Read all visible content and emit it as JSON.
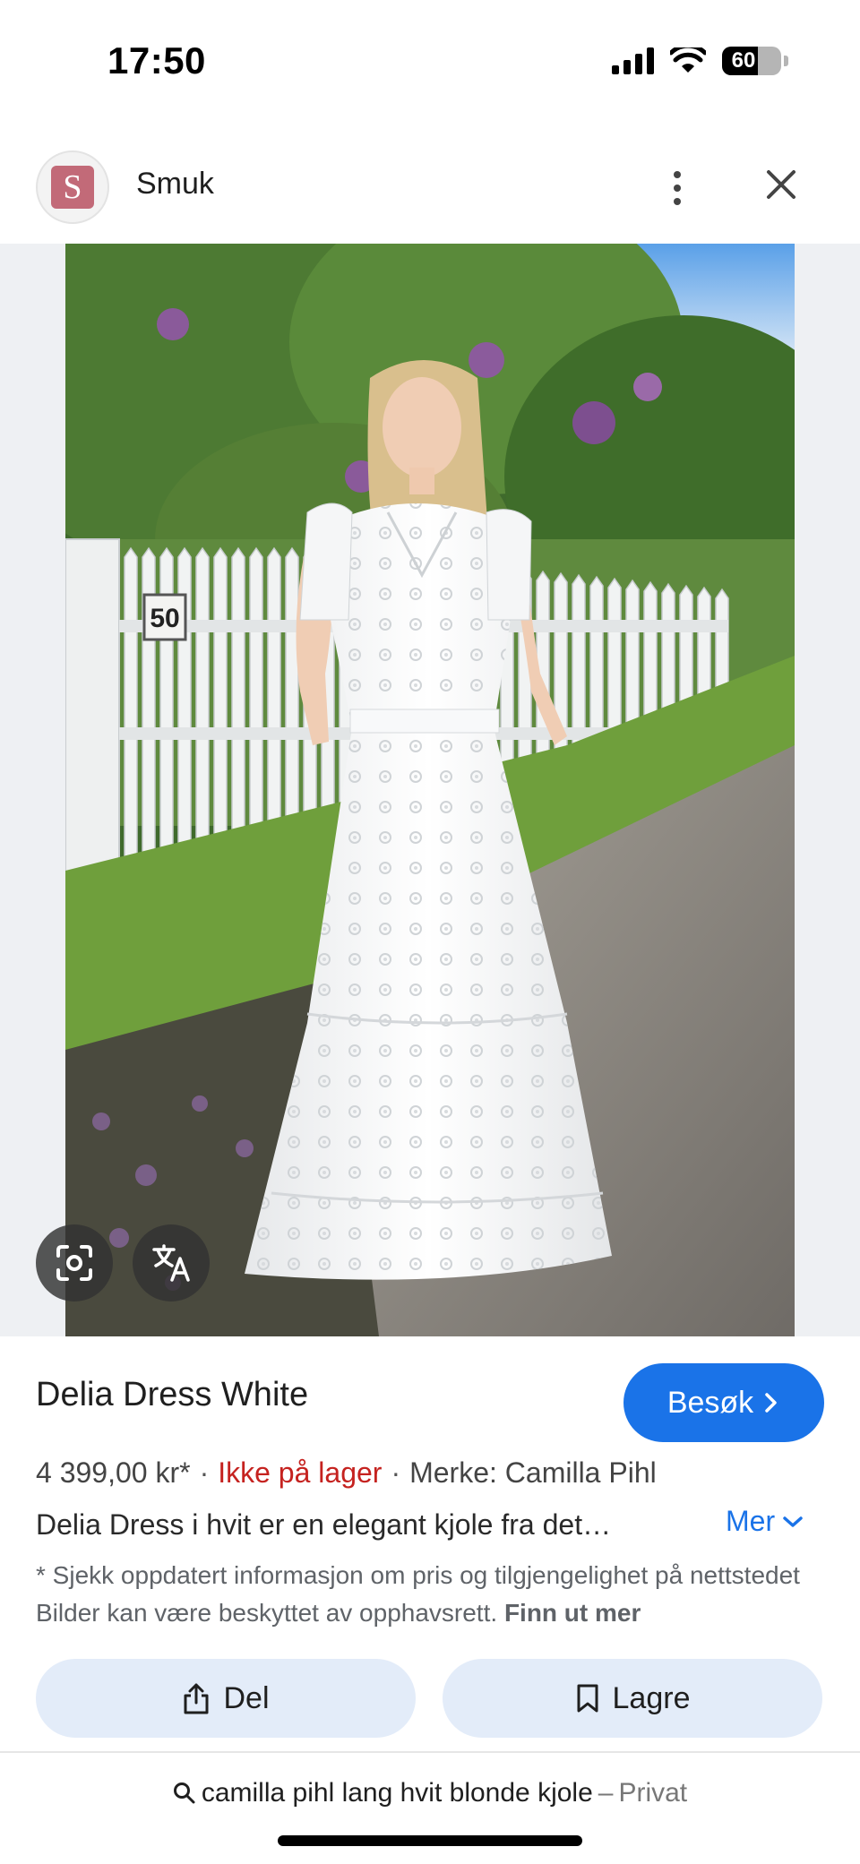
{
  "status_bar": {
    "time": "17:50",
    "battery": "60",
    "battery_level": 0.6,
    "icons": [
      "signal-icon",
      "wifi-icon",
      "battery-icon"
    ]
  },
  "header": {
    "site_logo_letter": "S",
    "site_name": "Smuk",
    "icons": [
      "more-vert-icon",
      "close-icon"
    ]
  },
  "image": {
    "house_number": "50",
    "overlay_icons": [
      "lens-icon",
      "translate-icon"
    ]
  },
  "product": {
    "title": "Delia Dress White",
    "visit_label": "Besøk",
    "price": "4 399,00 kr*",
    "separator": "·",
    "stock": "Ikke på lager",
    "brand": "Merke: Camilla Pihl",
    "description": "Delia Dress i hvit er en elegant kjole fra det…",
    "more_label": "Mer",
    "disclaimer": "* Sjekk oppdatert informasjon om pris og tilgjengelighet på nettstedet Bilder kan være beskyttet av opphavsrett.",
    "learn_more": "Finn ut mer"
  },
  "actions": {
    "share_label": "Del",
    "save_label": "Lagre"
  },
  "search": {
    "query": "camilla pihl lang hvit blonde kjole",
    "separator": "–",
    "mode": "Privat"
  },
  "colors": {
    "accent": "#1a73e8",
    "out_of_stock": "#c5221f",
    "action_bg": "#e3ecf9",
    "logo": "#c26a78"
  }
}
